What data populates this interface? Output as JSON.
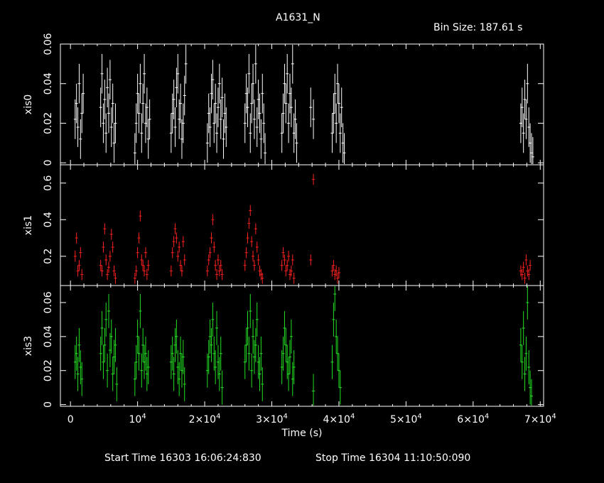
{
  "header": {
    "title": "A1631_N",
    "bin_size": "Bin Size: 187.61 s"
  },
  "footer": {
    "start_time": "Start Time 16303 16:06:24:830",
    "stop_time": "Stop Time 16304 11:10:50:090"
  },
  "chart_data": {
    "type": "scatter",
    "title": "A1631_N",
    "xlabel": "Time (s)",
    "xlim": [
      -1500,
      70500
    ],
    "x_ticks": [
      0,
      10000,
      20000,
      30000,
      40000,
      50000,
      60000,
      70000
    ],
    "x_tick_labels": [
      "0",
      "10^4",
      "2×10^4",
      "3×10^4",
      "4×10^4",
      "5×10^4",
      "6×10^4",
      "7×10^4"
    ],
    "colors": {
      "xis0": "#ffffff",
      "xis1": "#ff2020",
      "xis3": "#22e022",
      "axes": "#ffffff",
      "background": "#000000"
    },
    "panels": [
      {
        "name": "xis0",
        "ylabel": "xis0",
        "ylim": [
          -0.001,
          0.06
        ],
        "y_ticks": [
          0,
          0.02,
          0.04,
          0.06
        ],
        "y_tick_labels": [
          "0",
          "0.02",
          "0.04",
          "0.06"
        ],
        "series": [
          {
            "name": "xis0",
            "err": 0.01,
            "x": [
              700,
              900,
              1100,
              1300,
              1500,
              1700,
              1900,
              4500,
              4700,
              4900,
              5100,
              5300,
              5500,
              5700,
              5900,
              6100,
              6300,
              6500,
              6700,
              9600,
              9800,
              10000,
              10200,
              10400,
              10600,
              10800,
              11000,
              11200,
              11400,
              11600,
              11800,
              15000,
              15200,
              15400,
              15600,
              15800,
              16000,
              16200,
              16400,
              16600,
              16800,
              17000,
              17200,
              20400,
              20600,
              20800,
              21000,
              21200,
              21400,
              21600,
              21800,
              22000,
              22200,
              22400,
              22600,
              22800,
              23000,
              23200,
              26000,
              26200,
              26400,
              26600,
              26800,
              27000,
              27200,
              27400,
              27600,
              27800,
              28000,
              28200,
              28400,
              28600,
              28800,
              29000,
              31500,
              31700,
              31900,
              32100,
              32300,
              32500,
              32700,
              32900,
              33100,
              33300,
              33500,
              33700,
              35800,
              36200,
              39000,
              39200,
              39400,
              39600,
              39800,
              40000,
              40200,
              40400,
              40600,
              40800,
              67100,
              67300,
              67500,
              67700,
              67900,
              68100,
              68300,
              68500,
              68700,
              68900
            ],
            "y": [
              0.022,
              0.03,
              0.018,
              0.04,
              0.012,
              0.025,
              0.035,
              0.028,
              0.045,
              0.02,
              0.032,
              0.015,
              0.038,
              0.025,
              0.042,
              0.018,
              0.03,
              0.01,
              0.02,
              0.005,
              0.02,
              0.035,
              0.025,
              0.04,
              0.015,
              0.03,
              0.045,
              0.02,
              0.028,
              0.012,
              0.022,
              0.015,
              0.025,
              0.032,
              0.018,
              0.038,
              0.045,
              0.022,
              0.03,
              0.012,
              0.02,
              0.034,
              0.05,
              0.01,
              0.025,
              0.018,
              0.035,
              0.042,
              0.02,
              0.03,
              0.015,
              0.028,
              0.04,
              0.022,
              0.033,
              0.012,
              0.025,
              0.018,
              0.02,
              0.035,
              0.028,
              0.045,
              0.015,
              0.03,
              0.04,
              0.022,
              0.05,
              0.018,
              0.032,
              0.025,
              0.012,
              0.035,
              0.02,
              0.005,
              0.015,
              0.025,
              0.04,
              0.03,
              0.045,
              0.02,
              0.035,
              0.028,
              0.05,
              0.015,
              0.022,
              0.01,
              0.028,
              0.022,
              0.015,
              0.025,
              0.035,
              0.02,
              0.04,
              0.03,
              0.015,
              0.028,
              0.01,
              0.005,
              0.02,
              0.028,
              0.015,
              0.032,
              0.022,
              0.04,
              0.018,
              0.01,
              0.005,
              0.003
            ]
          }
        ]
      },
      {
        "name": "xis1",
        "ylabel": "xis1",
        "ylim": [
          0.04,
          0.7
        ],
        "y_ticks": [
          0.2,
          0.4,
          0.6
        ],
        "y_tick_labels": [
          "0.2",
          "0.4",
          "0.6"
        ],
        "series": [
          {
            "name": "xis1",
            "err": 0.03,
            "x": [
              700,
              900,
              1100,
              1300,
              1500,
              1700,
              4500,
              4700,
              4900,
              5100,
              5300,
              5500,
              5700,
              5900,
              6100,
              6300,
              6500,
              6700,
              9600,
              9800,
              10000,
              10200,
              10400,
              10600,
              10800,
              11000,
              11200,
              11400,
              11600,
              15000,
              15200,
              15400,
              15600,
              15800,
              16000,
              16200,
              16400,
              16600,
              16800,
              17000,
              20400,
              20600,
              20800,
              21000,
              21200,
              21400,
              21600,
              21800,
              22000,
              22200,
              22400,
              22600,
              26000,
              26200,
              26400,
              26600,
              26800,
              27000,
              27200,
              27400,
              27600,
              27800,
              28000,
              28200,
              28400,
              28600,
              31500,
              31700,
              31900,
              32100,
              32300,
              32500,
              32700,
              32900,
              33100,
              33300,
              35800,
              36200,
              39000,
              39200,
              39400,
              39600,
              39800,
              40000,
              67100,
              67300,
              67500,
              67700,
              67900,
              68100,
              68300,
              68500
            ],
            "y": [
              0.2,
              0.3,
              0.12,
              0.15,
              0.22,
              0.1,
              0.15,
              0.12,
              0.25,
              0.35,
              0.18,
              0.1,
              0.14,
              0.2,
              0.32,
              0.25,
              0.12,
              0.08,
              0.08,
              0.12,
              0.22,
              0.3,
              0.42,
              0.18,
              0.15,
              0.12,
              0.22,
              0.1,
              0.15,
              0.12,
              0.22,
              0.28,
              0.35,
              0.3,
              0.2,
              0.25,
              0.15,
              0.12,
              0.28,
              0.18,
              0.12,
              0.18,
              0.22,
              0.3,
              0.4,
              0.25,
              0.15,
              0.1,
              0.18,
              0.12,
              0.15,
              0.1,
              0.15,
              0.22,
              0.3,
              0.38,
              0.45,
              0.28,
              0.2,
              0.15,
              0.35,
              0.25,
              0.18,
              0.12,
              0.1,
              0.08,
              0.15,
              0.22,
              0.18,
              0.12,
              0.15,
              0.2,
              0.1,
              0.12,
              0.18,
              0.08,
              0.18,
              0.62,
              0.12,
              0.15,
              0.1,
              0.12,
              0.08,
              0.11,
              0.12,
              0.1,
              0.14,
              0.08,
              0.18,
              0.12,
              0.1,
              0.15
            ]
          }
        ]
      },
      {
        "name": "xis3",
        "ylabel": "xis3",
        "ylim": [
          -0.001,
          0.07
        ],
        "y_ticks": [
          0,
          0.02,
          0.04,
          0.06
        ],
        "y_tick_labels": [
          "0",
          "0.02",
          "0.04",
          "0.06"
        ],
        "series": [
          {
            "name": "xis3",
            "err": 0.01,
            "x": [
              700,
              900,
              1100,
              1300,
              1500,
              1700,
              4500,
              4700,
              4900,
              5100,
              5300,
              5500,
              5700,
              5900,
              6100,
              6300,
              6500,
              6700,
              6900,
              9600,
              9800,
              10000,
              10200,
              10400,
              10600,
              10800,
              11000,
              11200,
              11400,
              11600,
              15000,
              15200,
              15400,
              15600,
              15800,
              16000,
              16200,
              16400,
              16600,
              16800,
              17000,
              20400,
              20600,
              20800,
              21000,
              21200,
              21400,
              21600,
              21800,
              22000,
              22200,
              22400,
              22600,
              26000,
              26200,
              26400,
              26600,
              26800,
              27000,
              27200,
              27400,
              27600,
              27800,
              28000,
              28200,
              28400,
              28600,
              31500,
              31700,
              31900,
              32100,
              32300,
              32500,
              32700,
              32900,
              33100,
              33300,
              36200,
              39000,
              39200,
              39400,
              39600,
              39800,
              40000,
              40200,
              67100,
              67300,
              67500,
              67700,
              67900,
              68100,
              68300,
              68500,
              68700
            ],
            "y": [
              0.025,
              0.03,
              0.018,
              0.035,
              0.022,
              0.015,
              0.03,
              0.045,
              0.025,
              0.035,
              0.05,
              0.02,
              0.055,
              0.032,
              0.04,
              0.018,
              0.028,
              0.035,
              0.012,
              0.015,
              0.025,
              0.04,
              0.03,
              0.055,
              0.02,
              0.035,
              0.025,
              0.03,
              0.018,
              0.022,
              0.025,
              0.03,
              0.018,
              0.035,
              0.04,
              0.022,
              0.015,
              0.03,
              0.02,
              0.028,
              0.012,
              0.02,
              0.028,
              0.04,
              0.035,
              0.05,
              0.03,
              0.022,
              0.045,
              0.025,
              0.018,
              0.03,
              0.01,
              0.025,
              0.035,
              0.045,
              0.03,
              0.055,
              0.02,
              0.04,
              0.028,
              0.035,
              0.05,
              0.025,
              0.018,
              0.03,
              0.012,
              0.022,
              0.03,
              0.045,
              0.035,
              0.025,
              0.018,
              0.028,
              0.04,
              0.015,
              0.022,
              0.008,
              0.025,
              0.05,
              0.065,
              0.04,
              0.03,
              0.02,
              0.01,
              0.035,
              0.025,
              0.045,
              0.018,
              0.03,
              0.06,
              0.022,
              0.01,
              0.005
            ]
          }
        ]
      }
    ]
  }
}
